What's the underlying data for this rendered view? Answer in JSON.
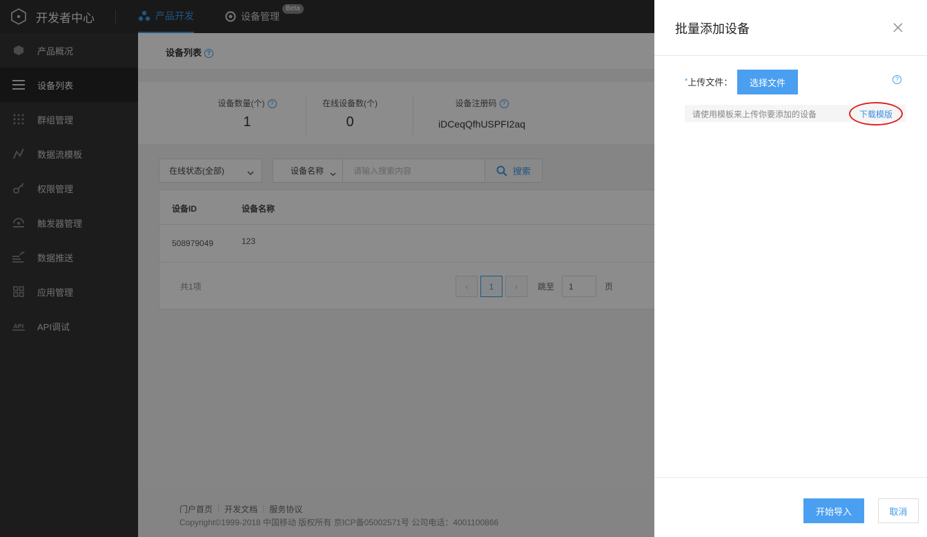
{
  "topbar": {
    "brand": "开发者中心",
    "tabs": [
      {
        "label": "产品开发",
        "icon": "molecule-icon",
        "active": true
      },
      {
        "label": "设备管理",
        "icon": "device-icon",
        "badge": "Beta"
      }
    ]
  },
  "sidebar": {
    "items": [
      {
        "label": "产品概况",
        "icon": "cube-icon"
      },
      {
        "label": "设备列表",
        "icon": "list-icon",
        "active": true
      },
      {
        "label": "群组管理",
        "icon": "grid-dots-icon"
      },
      {
        "label": "数据流模板",
        "icon": "stream-icon"
      },
      {
        "label": "权限管理",
        "icon": "key-icon"
      },
      {
        "label": "触发器管理",
        "icon": "trigger-icon"
      },
      {
        "label": "数据推送",
        "icon": "push-icon"
      },
      {
        "label": "应用管理",
        "icon": "apps-icon"
      },
      {
        "label": "API调试",
        "icon": "api-icon"
      }
    ]
  },
  "main": {
    "title": "设备列表",
    "stats": [
      {
        "label": "设备数量(个)",
        "value": "1"
      },
      {
        "label": "在线设备数(个)",
        "value": "0"
      },
      {
        "label": "设备注册码",
        "value": "iDCeqQfhUSPFI2aq"
      }
    ],
    "filter": {
      "status": "在线状态(全部)",
      "field": "设备名称",
      "search_placeholder": "请输入搜索内容",
      "search_label": "搜索"
    },
    "table": {
      "columns": [
        "设备ID",
        "设备名称"
      ],
      "rows": [
        [
          "508979049",
          "123"
        ]
      ]
    },
    "pager": {
      "total": "共1项",
      "current": "1",
      "prev": "‹",
      "next": "›",
      "goto_label": "跳至",
      "goto_value": "1",
      "page_unit": "页"
    },
    "footer": {
      "links": [
        "门户首页",
        "开发文档",
        "服务协议"
      ],
      "copyright": "Copyright©1999-2018 中国移动 版权所有 京ICP备05002571号 公司电话：4001100866"
    }
  },
  "drawer": {
    "title": "批量添加设备",
    "upload_required_mark": "*",
    "upload_label": "上传文件：",
    "choose_file": "选择文件",
    "hint": "请使用模板来上传你要添加的设备",
    "download_template": "下载模版",
    "start_import": "开始导入",
    "cancel": "取消"
  },
  "colors": {
    "accent": "#3d9be9",
    "primary_button": "#4a9ff0",
    "topbar": "#2f2f2f",
    "sidebar": "#333333",
    "highlight_ring": "#e02020"
  }
}
